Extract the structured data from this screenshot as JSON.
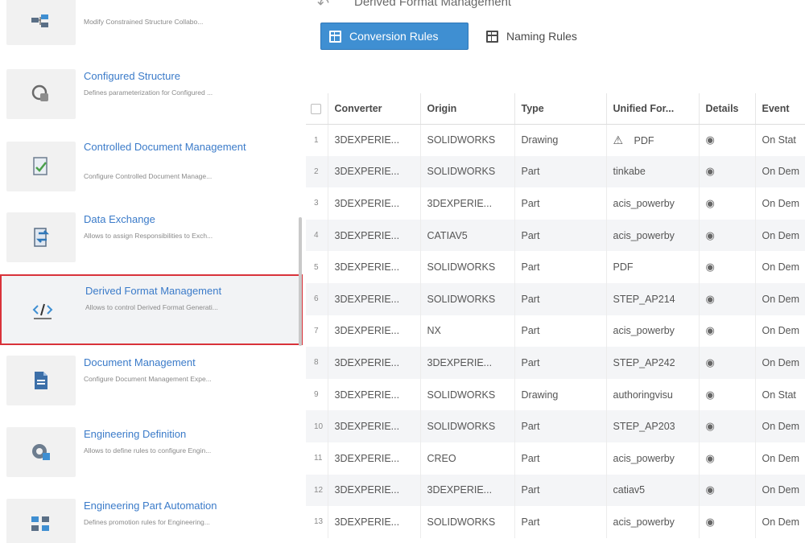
{
  "sidebar": {
    "items": [
      {
        "title": "",
        "desc": "Modify Constrained Structure Collabo...",
        "icon": "structure-collab-icon"
      },
      {
        "title": "Configured Structure",
        "desc": "Defines parameterization for Configured ...",
        "icon": "configured-structure-icon"
      },
      {
        "title": "Controlled Document Management",
        "desc": "Configure Controlled Document Manage...",
        "icon": "controlled-document-icon"
      },
      {
        "title": "Data Exchange",
        "desc": "Allows to assign Responsibilities to Exch...",
        "icon": "data-exchange-icon"
      },
      {
        "title": "Derived Format Management",
        "desc": "Allows to control Derived Format Generati...",
        "icon": "derived-format-icon"
      },
      {
        "title": "Document Management",
        "desc": "Configure Document Management Expe...",
        "icon": "document-management-icon"
      },
      {
        "title": "Engineering Definition",
        "desc": "Allows to define rules to configure Engin...",
        "icon": "engineering-definition-icon"
      },
      {
        "title": "Engineering Part Automation",
        "desc": "Defines promotion rules for Engineering...",
        "icon": "engineering-part-automation-icon"
      }
    ],
    "selected_index": 4
  },
  "header": {
    "title": "Derived Format Management",
    "back_icon": "back-arrow-icon"
  },
  "tabs": [
    {
      "label": "Conversion Rules",
      "icon": "table-icon",
      "active": true
    },
    {
      "label": "Naming Rules",
      "icon": "table-icon",
      "active": false
    }
  ],
  "table": {
    "columns": [
      "Converter",
      "Origin",
      "Type",
      "Unified For...",
      "Details",
      "Event"
    ],
    "rows": [
      {
        "num": "1",
        "converter": "3DEXPERIE...",
        "origin": "SOLIDWORKS",
        "type": "Drawing",
        "format": "PDF",
        "warn": true,
        "event": "On Stat"
      },
      {
        "num": "2",
        "converter": "3DEXPERIE...",
        "origin": "SOLIDWORKS",
        "type": "Part",
        "format": "tinkabe",
        "warn": false,
        "event": "On Dem"
      },
      {
        "num": "3",
        "converter": "3DEXPERIE...",
        "origin": "3DEXPERIE...",
        "type": "Part",
        "format": "acis_powerby",
        "warn": false,
        "event": "On Dem"
      },
      {
        "num": "4",
        "converter": "3DEXPERIE...",
        "origin": "CATIAV5",
        "type": "Part",
        "format": "acis_powerby",
        "warn": false,
        "event": "On Dem"
      },
      {
        "num": "5",
        "converter": "3DEXPERIE...",
        "origin": "SOLIDWORKS",
        "type": "Part",
        "format": "PDF",
        "warn": false,
        "event": "On Dem"
      },
      {
        "num": "6",
        "converter": "3DEXPERIE...",
        "origin": "SOLIDWORKS",
        "type": "Part",
        "format": "STEP_AP214",
        "warn": false,
        "event": "On Dem"
      },
      {
        "num": "7",
        "converter": "3DEXPERIE...",
        "origin": "NX",
        "type": "Part",
        "format": "acis_powerby",
        "warn": false,
        "event": "On Dem"
      },
      {
        "num": "8",
        "converter": "3DEXPERIE...",
        "origin": "3DEXPERIE...",
        "type": "Part",
        "format": "STEP_AP242",
        "warn": false,
        "event": "On Dem"
      },
      {
        "num": "9",
        "converter": "3DEXPERIE...",
        "origin": "SOLIDWORKS",
        "type": "Drawing",
        "format": "authoringvisu",
        "warn": false,
        "event": "On Stat"
      },
      {
        "num": "10",
        "converter": "3DEXPERIE...",
        "origin": "SOLIDWORKS",
        "type": "Part",
        "format": "STEP_AP203",
        "warn": false,
        "event": "On Dem"
      },
      {
        "num": "11",
        "converter": "3DEXPERIE...",
        "origin": "CREO",
        "type": "Part",
        "format": "acis_powerby",
        "warn": false,
        "event": "On Dem"
      },
      {
        "num": "12",
        "converter": "3DEXPERIE...",
        "origin": "3DEXPERIE...",
        "type": "Part",
        "format": "catiav5",
        "warn": false,
        "event": "On Dem"
      },
      {
        "num": "13",
        "converter": "3DEXPERIE...",
        "origin": "SOLIDWORKS",
        "type": "Part",
        "format": "acis_powerby",
        "warn": false,
        "event": "On Dem"
      }
    ]
  },
  "colors": {
    "accent": "#3f8fd2",
    "link": "#3b7bc9",
    "selection_border": "#d9323a",
    "row_stripe": "#f4f5f7"
  }
}
